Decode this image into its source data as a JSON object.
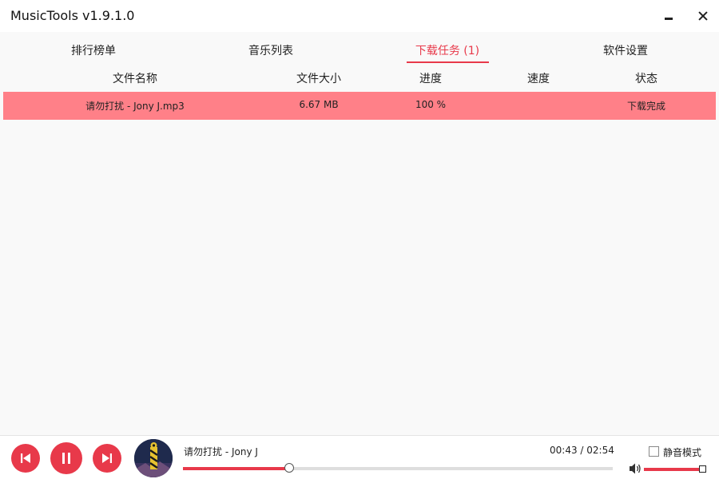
{
  "window": {
    "title": "MusicTools v1.9.1.0"
  },
  "tabs": [
    {
      "label": "排行榜单",
      "active": false
    },
    {
      "label": "音乐列表",
      "active": false
    },
    {
      "label": "下载任务 (1)",
      "active": true
    },
    {
      "label": "软件设置",
      "active": false
    }
  ],
  "table": {
    "columns": [
      "文件名称",
      "文件大小",
      "进度",
      "速度",
      "状态"
    ],
    "rows": [
      {
        "name": "请勿打扰  - Jony J.mp3",
        "size": "6.67 MB",
        "progress": "100 %",
        "speed": "",
        "status": "下载完成"
      }
    ]
  },
  "player": {
    "song": "请勿打扰  - Jony J",
    "time": "00:43  /  02:54",
    "progress_fraction": 0.247,
    "volume_fraction": 0.97,
    "mute_label": "静音模式",
    "mute_checked": false
  },
  "icons": {
    "prev": "skip-previous-icon",
    "pause": "pause-icon",
    "next": "skip-next-icon",
    "volume": "volume-icon",
    "minimize": "minimize-icon",
    "close": "close-icon"
  },
  "colors": {
    "accent": "#e8394a",
    "row_highlight": "#ff8088"
  }
}
